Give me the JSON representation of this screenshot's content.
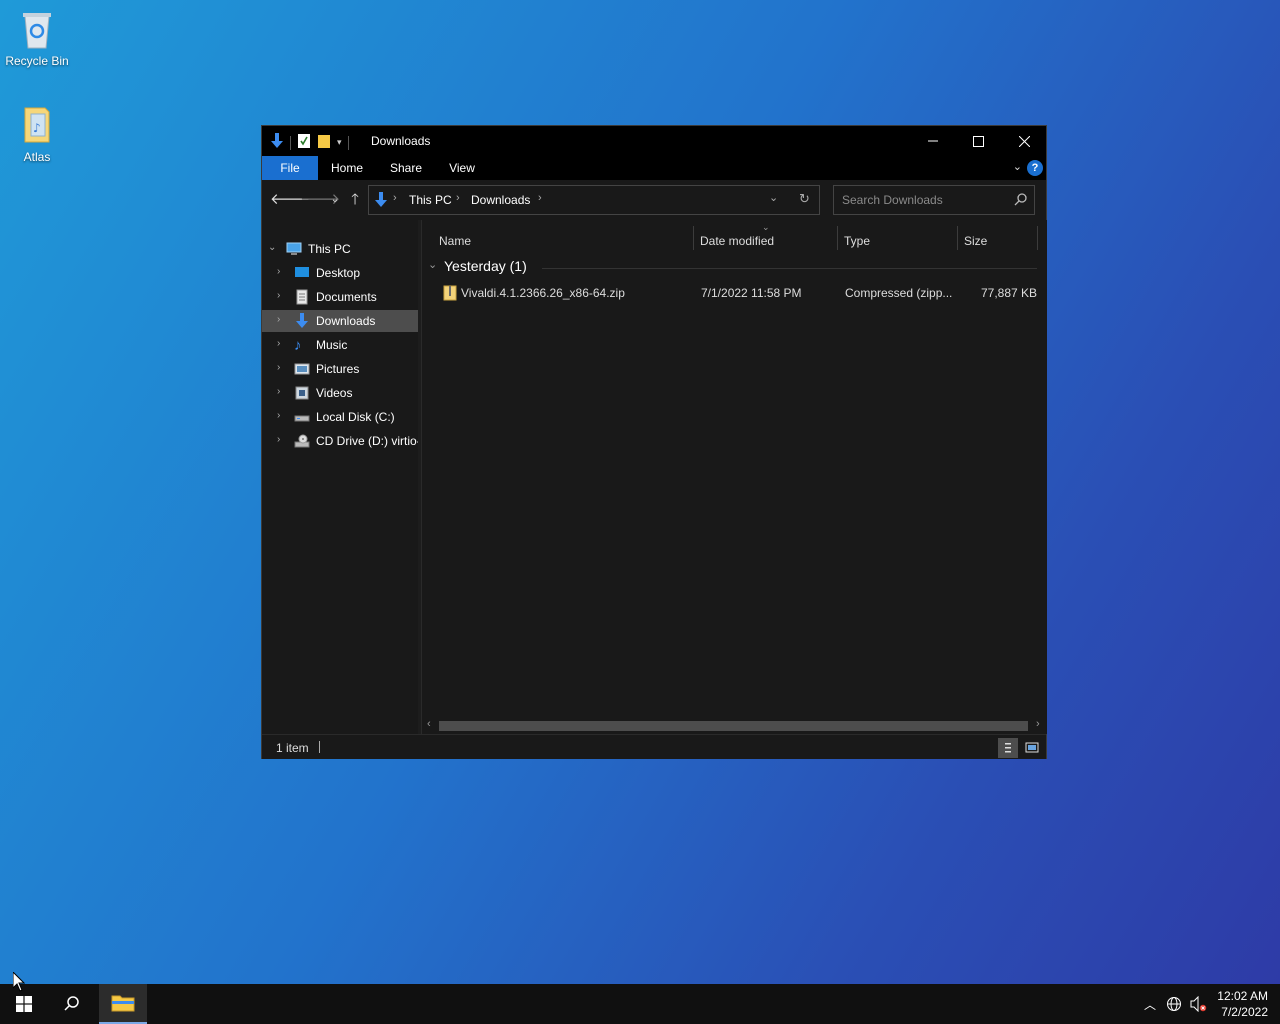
{
  "desktop": {
    "icons": [
      {
        "label": "Recycle Bin",
        "icon": "recycle-bin-icon"
      },
      {
        "label": "Atlas",
        "icon": "folder-icon"
      }
    ]
  },
  "window": {
    "title": "Downloads",
    "ribbon": {
      "file": "File",
      "home": "Home",
      "share": "Share",
      "view": "View",
      "help": "?"
    },
    "address": {
      "crumbs": [
        "This PC",
        "Downloads"
      ]
    },
    "search": {
      "placeholder": "Search Downloads"
    },
    "nav": [
      {
        "label": "This PC",
        "icon": "this-pc-icon"
      },
      {
        "label": "Desktop",
        "icon": "desktop-icon"
      },
      {
        "label": "Documents",
        "icon": "documents-icon"
      },
      {
        "label": "Downloads",
        "icon": "downloads-icon",
        "selected": true
      },
      {
        "label": "Music",
        "icon": "music-icon"
      },
      {
        "label": "Pictures",
        "icon": "pictures-icon"
      },
      {
        "label": "Videos",
        "icon": "videos-icon"
      },
      {
        "label": "Local Disk (C:)",
        "icon": "local-disk-icon"
      },
      {
        "label": "CD Drive (D:) virtio-",
        "icon": "cd-drive-icon"
      }
    ],
    "columns": {
      "name": "Name",
      "date": "Date modified",
      "type": "Type",
      "size": "Size"
    },
    "group": {
      "label": "Yesterday (1)"
    },
    "files": [
      {
        "name": "Vivaldi.4.1.2366.26_x86-64.zip",
        "date": "7/1/2022 11:58 PM",
        "type": "Compressed (zipp...",
        "size": "77,887 KB"
      }
    ],
    "status": {
      "count": "1 item"
    }
  },
  "taskbar": {
    "clock": {
      "time": "12:02 AM",
      "date": "7/2/2022"
    }
  },
  "colors": {
    "accent": "#1a6fd0",
    "selected": "#4d4d4d",
    "background": "#191919"
  }
}
